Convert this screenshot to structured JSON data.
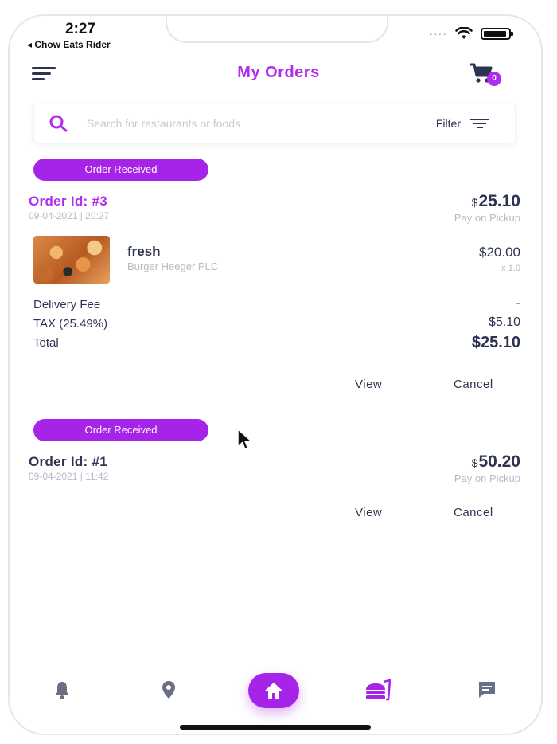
{
  "status_bar": {
    "time": "2:27",
    "back_label": "◂ Chow Eats Rider",
    "signal_dots": "····"
  },
  "header": {
    "title": "My Orders",
    "cart_count": "0"
  },
  "search": {
    "placeholder": "Search for restaurants or foods",
    "filter_label": "Filter"
  },
  "orders": [
    {
      "status": "Order Received",
      "order_id": "Order Id: #3",
      "datetime": "09-04-2021 | 20:27",
      "total_currency": "$",
      "total_amount": "25.10",
      "payment_method": "Pay on Pickup",
      "items": [
        {
          "name": "fresh",
          "restaurant": "Burger Heeger PLC",
          "price": "$20.00",
          "quantity": "x 1.0"
        }
      ],
      "summary": {
        "delivery_fee_label": "Delivery Fee",
        "delivery_fee_value": "-",
        "tax_label": "TAX (25.49%)",
        "tax_value": "$5.10",
        "total_label": "Total",
        "total_value": "$25.10"
      },
      "actions": {
        "view": "View",
        "cancel": "Cancel"
      }
    },
    {
      "status": "Order Received",
      "order_id": "Order Id: #1",
      "datetime": "09-04-2021 | 11:42",
      "total_currency": "$",
      "total_amount": "50.20",
      "payment_method": "Pay on Pickup",
      "actions": {
        "view": "View",
        "cancel": "Cancel"
      }
    }
  ],
  "bottom_nav": {
    "items": [
      "bell-icon",
      "location-pin-icon",
      "home-icon",
      "food-icon",
      "chat-icon"
    ],
    "active": "home-icon"
  },
  "colors": {
    "accent": "#a624e8",
    "title": "#b02cf0",
    "text": "#2d3350",
    "muted": "#b9bac4"
  }
}
